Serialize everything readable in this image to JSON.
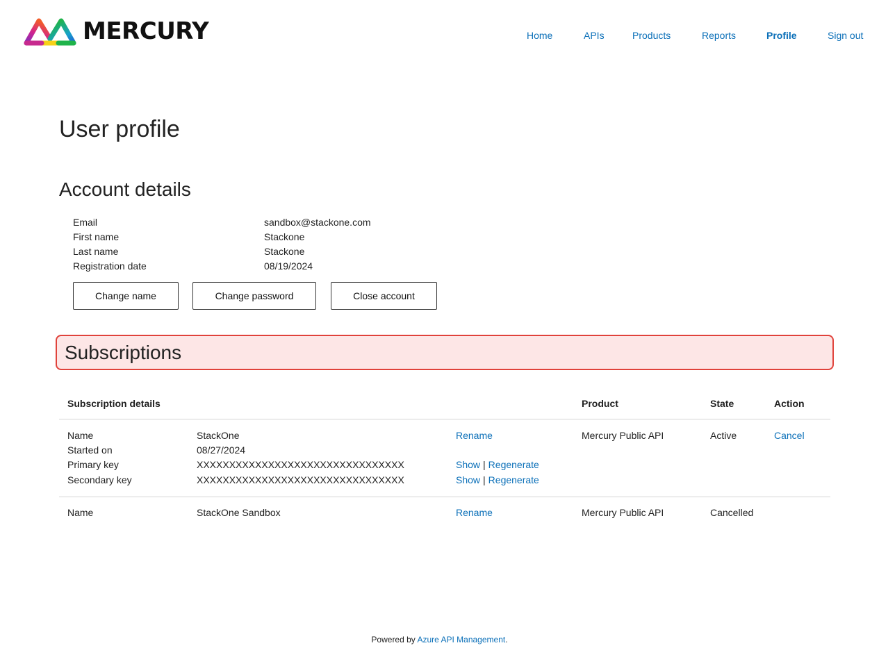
{
  "brand": {
    "name": "MERCURY",
    "colors": [
      "#7b2fbe",
      "#e0218a",
      "#f7d117",
      "#1fb34a",
      "#1e88e5"
    ]
  },
  "nav": {
    "items": [
      {
        "label": "Home",
        "active": false
      },
      {
        "label": "APIs",
        "active": false
      },
      {
        "label": "Products",
        "active": false
      },
      {
        "label": "Reports",
        "active": false
      },
      {
        "label": "Profile",
        "active": true
      },
      {
        "label": "Sign out",
        "active": false
      }
    ]
  },
  "page": {
    "title": "User profile"
  },
  "account": {
    "title": "Account details",
    "fields": [
      {
        "label": "Email",
        "value": "sandbox@stackone.com"
      },
      {
        "label": "First name",
        "value": "Stackone"
      },
      {
        "label": "Last name",
        "value": "Stackone"
      },
      {
        "label": "Registration date",
        "value": "08/19/2024"
      }
    ],
    "buttons": {
      "change_name": "Change name",
      "change_password": "Change password",
      "close_account": "Close account"
    }
  },
  "subscriptions": {
    "title": "Subscriptions",
    "highlight_color": "#e0423b",
    "headers": {
      "details": "Subscription details",
      "product": "Product",
      "state": "State",
      "action": "Action"
    },
    "rows": [
      {
        "name_label": "Name",
        "name": "StackOne",
        "rename": "Rename",
        "started_label": "Started on",
        "started": "08/27/2024",
        "primary_label": "Primary key",
        "primary_key": "XXXXXXXXXXXXXXXXXXXXXXXXXXXXXXXX",
        "secondary_label": "Secondary key",
        "secondary_key": "XXXXXXXXXXXXXXXXXXXXXXXXXXXXXXXX",
        "show": "Show",
        "separator": "|",
        "regenerate": "Regenerate",
        "product": "Mercury Public API",
        "state": "Active",
        "action": "Cancel"
      },
      {
        "name_label": "Name",
        "name": "StackOne Sandbox",
        "rename": "Rename",
        "product": "Mercury Public API",
        "state": "Cancelled"
      }
    ]
  },
  "footer": {
    "prefix": "Powered by ",
    "link": "Azure API Management",
    "suffix": "."
  },
  "link_color": "#0a6fb8"
}
